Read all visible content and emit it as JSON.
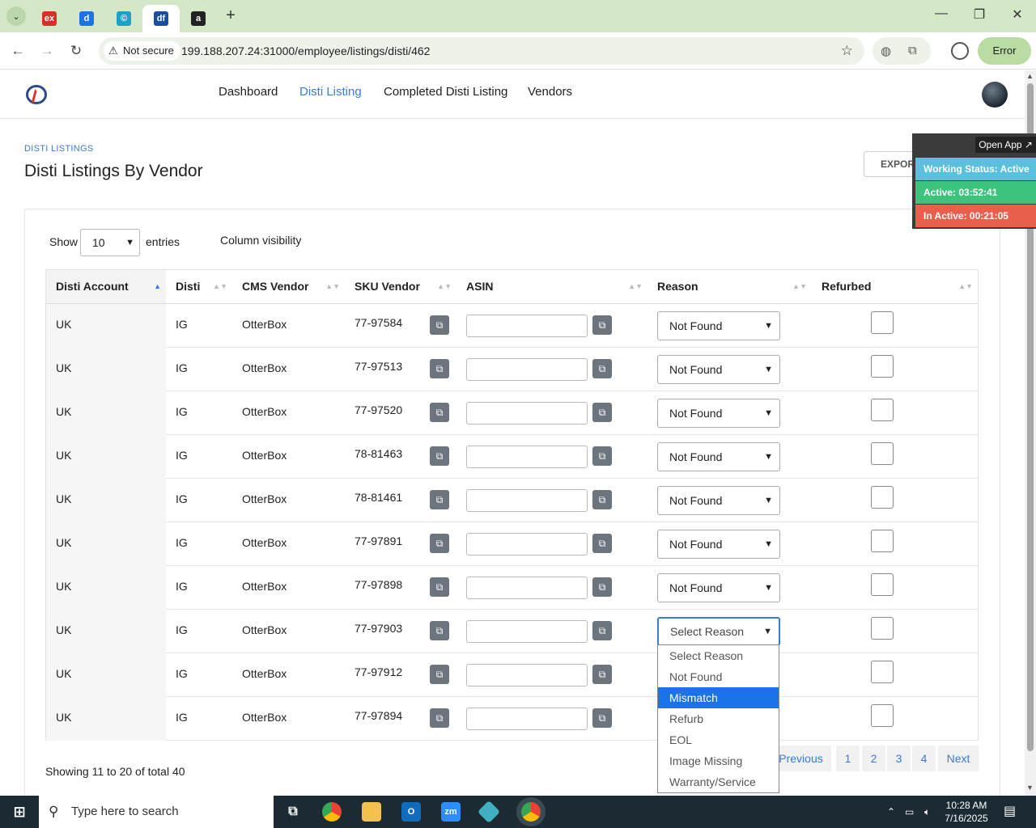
{
  "browser": {
    "tabs": [
      {
        "icon": "ex-favicon-icon",
        "text": "ex",
        "color": "#d93025"
      },
      {
        "icon": "doc-favicon-icon",
        "text": "d",
        "color": "#1a73e8"
      },
      {
        "icon": "c-favicon-icon",
        "text": "©",
        "color": "#1aa3c8"
      },
      {
        "icon": "df-favicon-icon",
        "text": "df",
        "color": "#1a4fa0"
      },
      {
        "icon": "amazon-favicon-icon",
        "text": "a",
        "color": "#222222"
      }
    ],
    "security_label": "Not secure",
    "url": "199.188.207.24:31000/employee/listings/disti/462",
    "error_label": "Error"
  },
  "nav": {
    "items": [
      "Dashboard",
      "Disti Listing",
      "Completed Disti Listing",
      "Vendors"
    ],
    "active_index": 1
  },
  "page": {
    "breadcrumb": "DISTI LISTINGS",
    "title": "Disti Listings By Vendor",
    "export_label": "EXPORT DISTI LISTING"
  },
  "widget": {
    "open_app": "Open App ↗",
    "working_status": "Working Status: Active",
    "active": "Active: 03:52:41",
    "inactive": "In Active: 00:21:05",
    "colors": {
      "status": "#5bc0de",
      "active": "#3cc47c",
      "inactive": "#e8604c"
    }
  },
  "controls": {
    "show_label": "Show",
    "entries_value": "10",
    "entries_label": "entries",
    "column_visibility": "Column visibility"
  },
  "table": {
    "headers": [
      "Disti Account",
      "Disti",
      "CMS Vendor",
      "SKU Vendor",
      "ASIN",
      "Reason",
      "Refurbed"
    ],
    "rows": [
      {
        "account": "UK",
        "disti": "IG",
        "vendor": "OtterBox",
        "sku": "77-97584",
        "asin": "",
        "reason": "Not Found"
      },
      {
        "account": "UK",
        "disti": "IG",
        "vendor": "OtterBox",
        "sku": "77-97513",
        "asin": "",
        "reason": "Not Found"
      },
      {
        "account": "UK",
        "disti": "IG",
        "vendor": "OtterBox",
        "sku": "77-97520",
        "asin": "",
        "reason": "Not Found"
      },
      {
        "account": "UK",
        "disti": "IG",
        "vendor": "OtterBox",
        "sku": "78-81463",
        "asin": "",
        "reason": "Not Found"
      },
      {
        "account": "UK",
        "disti": "IG",
        "vendor": "OtterBox",
        "sku": "78-81461",
        "asin": "",
        "reason": "Not Found"
      },
      {
        "account": "UK",
        "disti": "IG",
        "vendor": "OtterBox",
        "sku": "77-97891",
        "asin": "",
        "reason": "Not Found"
      },
      {
        "account": "UK",
        "disti": "IG",
        "vendor": "OtterBox",
        "sku": "77-97898",
        "asin": "",
        "reason": "Not Found"
      },
      {
        "account": "UK",
        "disti": "IG",
        "vendor": "OtterBox",
        "sku": "77-97903",
        "asin": "",
        "reason": "Select Reason"
      },
      {
        "account": "UK",
        "disti": "IG",
        "vendor": "OtterBox",
        "sku": "77-97912",
        "asin": "",
        "reason": ""
      },
      {
        "account": "UK",
        "disti": "IG",
        "vendor": "OtterBox",
        "sku": "77-97894",
        "asin": "",
        "reason": ""
      }
    ],
    "open_dropdown_row": 7
  },
  "reason_options": [
    "Select Reason",
    "Not Found",
    "Mismatch",
    "Refurb",
    "EOL",
    "Image Missing",
    "Warranty/Service"
  ],
  "highlighted_option": "Mismatch",
  "footer": {
    "showing": "Showing 11 to 20 of total 40",
    "pagination": [
      "Previous",
      "1",
      "2",
      "3",
      "4",
      "Next"
    ]
  },
  "taskbar": {
    "search_placeholder": "Type here to search",
    "time": "10:28 AM",
    "date": "7/16/2025"
  }
}
